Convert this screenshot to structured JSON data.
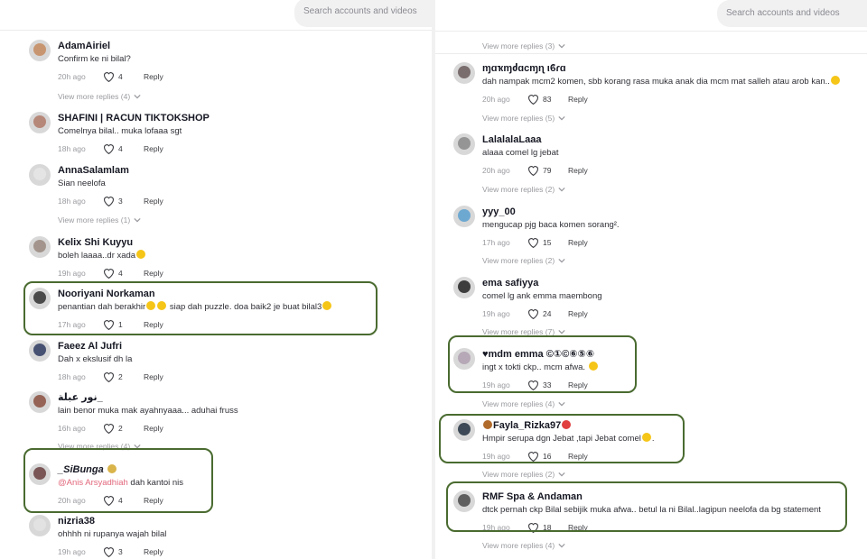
{
  "search": {
    "placeholder": "Search accounts and videos"
  },
  "left": {
    "comments": [
      {
        "user": "AdamAiriel",
        "text": "Confirm ke ni bilal?",
        "time": "20h ago",
        "likes": "4",
        "reply": "Reply",
        "avatar_color": "#c48b5f",
        "more": "View more replies (4)"
      },
      {
        "user": "SHAFINI | RACUN TIKTOKSHOP",
        "text": "Comelnya bilal.. muka lofaaa sgt",
        "time": "18h ago",
        "likes": "4",
        "reply": "Reply",
        "avatar_color": "#b07a6a",
        "more": ""
      },
      {
        "user": "AnnaSalamlam",
        "text": "Sian neelofa",
        "time": "18h ago",
        "likes": "3",
        "reply": "Reply",
        "avatar_color": "#cfcfcf",
        "more": "View more replies (1)"
      },
      {
        "user": "Kelix Shi Kuyyu",
        "text": "boleh laaaa..dr xada",
        "time": "19h ago",
        "likes": "4",
        "reply": "Reply",
        "avatar_color": "#9a8a80",
        "more": ""
      },
      {
        "user": "Nooriyani Norkaman",
        "text": "penantian dah berakhir",
        "text2": " siap dah puzzle. doa baik2 je buat bilal3",
        "time": "17h ago",
        "likes": "1",
        "reply": "Reply",
        "avatar_color": "#333333",
        "more": ""
      },
      {
        "user": "Faeez Al Jufri",
        "text": "Dah x ekslusif dh la",
        "time": "18h ago",
        "likes": "2",
        "reply": "Reply",
        "avatar_color": "#2e3a60",
        "more": ""
      },
      {
        "user": "نور عبلة_",
        "text": "lain benor muka mak ayahnyaaa... aduhai fruss",
        "time": "16h ago",
        "likes": "2",
        "reply": "Reply",
        "avatar_color": "#8a5040",
        "more": "View more replies (4)"
      },
      {
        "user": "_SiBunga",
        "mention": "@Anis Arsyadhiah",
        "text": " dah kantoi nis",
        "time": "20h ago",
        "likes": "4",
        "reply": "Reply",
        "avatar_color": "#6a4040",
        "more": ""
      },
      {
        "user": "nizria38",
        "text": "ohhhh ni rupanya wajah bilal",
        "time": "19h ago",
        "likes": "3",
        "reply": "Reply",
        "avatar_color": "#d6d6d6",
        "more": ""
      }
    ]
  },
  "right": {
    "top_more": "View more replies (3)",
    "comments": [
      {
        "user": "ɱɑҡɱძɑcɱɳ ιϐɾɑ",
        "text": "dah nampak mcm2 komen, sbb korang rasa muka anak dia mcm mat salleh atau arob kan..",
        "time": "20h ago",
        "likes": "83",
        "reply": "Reply",
        "avatar_color": "#6a5a5a",
        "more": "View more replies (5)"
      },
      {
        "user": "LalalalaLaaa",
        "text": "alaaa comel lg jebat",
        "time": "20h ago",
        "likes": "79",
        "reply": "Reply",
        "avatar_color": "#8a8a8a",
        "more": "View more replies (2)"
      },
      {
        "user": "yyy_00",
        "text": "mengucap pjg baca komen sorang².",
        "time": "17h ago",
        "likes": "15",
        "reply": "Reply",
        "avatar_color": "#5aa0d0",
        "more": "View more replies (2)"
      },
      {
        "user": "ema safiyya",
        "text": "comel lg ank emma maembong",
        "time": "19h ago",
        "likes": "24",
        "reply": "Reply",
        "avatar_color": "#222222",
        "more": "View more replies (7)"
      },
      {
        "user": "mdm emma ©①©⑥⑤⑥",
        "text": "ingt x tokti ckp.. mcm afwa.",
        "time": "19h ago",
        "likes": "33",
        "reply": "Reply",
        "avatar_color": "#b0a0b0",
        "more": "View more replies (4)"
      },
      {
        "user": "Fayla_Rizka97",
        "text": "Hmpir serupa dgn Jebat ,tapi Jebat comel",
        "time": "19h ago",
        "likes": "16",
        "reply": "Reply",
        "avatar_color": "#223040",
        "more": "View more replies (2)"
      },
      {
        "user": "RMF Spa & Andaman",
        "text": "dtck pernah ckp Bilal sebijik muka afwa.. betul la ni Bilal..lagipun neelofa da bg statement",
        "time": "19h ago",
        "likes": "18",
        "reply": "Reply",
        "avatar_color": "#4a4a4a",
        "more": "View more replies (4)"
      }
    ]
  },
  "colors": {
    "highlight": "#4a6b30",
    "mention": "#e2687c",
    "muted": "#9a9ba0"
  }
}
